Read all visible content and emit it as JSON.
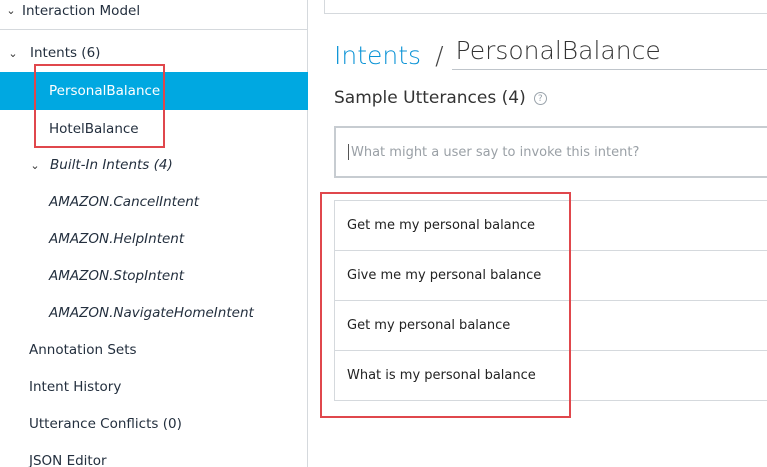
{
  "sidebar": {
    "interaction_model": "Interaction Model",
    "intents_label": "Intents (6)",
    "intents": [
      "PersonalBalance",
      "HotelBalance"
    ],
    "builtin_label": "Built-In Intents (4)",
    "builtin_intents": [
      "AMAZON.CancelIntent",
      "AMAZON.HelpIntent",
      "AMAZON.StopIntent",
      "AMAZON.NavigateHomeIntent"
    ],
    "annotation_sets": "Annotation Sets",
    "intent_history": "Intent History",
    "utterance_conflicts": "Utterance Conflicts (0)",
    "json_editor": "JSON Editor"
  },
  "main": {
    "breadcrumb_link": "Intents",
    "separator": "/",
    "intent_name": "PersonalBalance",
    "section_title": "Sample Utterances (4)",
    "help_glyph": "?",
    "input_placeholder": "What might a user say to invoke this intent?",
    "utterances": [
      "Get me my personal balance",
      "Give me my personal balance",
      "Get my personal balance",
      "What is my personal balance"
    ]
  },
  "colors": {
    "accent": "#00a8e1",
    "link": "#0b93d6",
    "annotation": "#e0474c"
  }
}
